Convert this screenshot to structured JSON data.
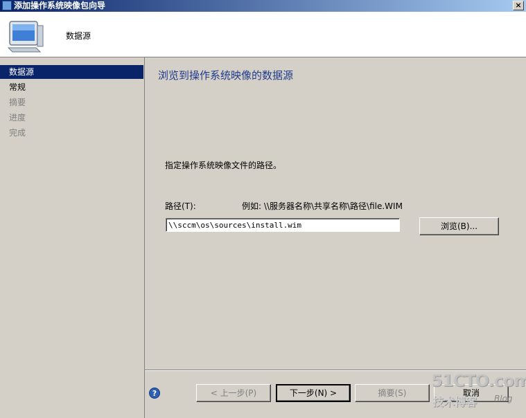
{
  "window": {
    "title": "添加操作系统映像包向导",
    "close_label": "×"
  },
  "header": {
    "title": "数据源"
  },
  "nav": {
    "items": [
      {
        "label": "数据源",
        "state": "selected"
      },
      {
        "label": "常规",
        "state": "enabled"
      },
      {
        "label": "摘要",
        "state": "disabled"
      },
      {
        "label": "进度",
        "state": "disabled"
      },
      {
        "label": "完成",
        "state": "disabled"
      }
    ]
  },
  "content": {
    "title": "浏览到操作系统映像的数据源",
    "instruction": "指定操作系统映像文件的路径。",
    "path_label": "路径(T):",
    "example": "例如: \\\\服务器名称\\共享名称\\路径\\file.WIM",
    "path_value": "\\\\sccm\\os\\sources\\install.wim",
    "browse_label": "浏览(B)..."
  },
  "footer": {
    "help_label": "?",
    "prev_label": "< 上一步(P)",
    "next_label": "下一步(N) >",
    "summary_label": "摘要(S)",
    "cancel_label": "取消"
  },
  "watermark": {
    "main": "51CTO.com",
    "sub": "技术博客",
    "blog": "Blog"
  },
  "colors": {
    "selected_bg": "#0a246a",
    "title_text": "#1f3a8b"
  }
}
